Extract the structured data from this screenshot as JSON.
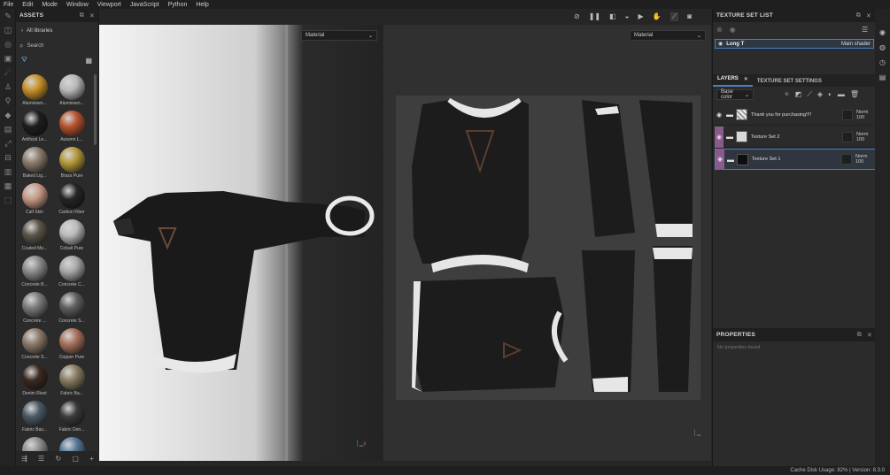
{
  "menu": [
    "File",
    "Edit",
    "Mode",
    "Window",
    "Viewport",
    "JavaScript",
    "Python",
    "Help"
  ],
  "assets": {
    "title": "ASSETS",
    "all_libraries": "All libraries",
    "search_placeholder": "Search",
    "materials": [
      {
        "label": "Aluminium...",
        "color": "#c9922a"
      },
      {
        "label": "Aluminium...",
        "color": "#b9b9b9"
      },
      {
        "label": "Artificial Le...",
        "color": "#1e1e1e"
      },
      {
        "label": "Autumn L...",
        "color": "#b8542f"
      },
      {
        "label": "Baked Lig...",
        "color": "#8c7c6c"
      },
      {
        "label": "Brass Pure",
        "color": "#b59a3a"
      },
      {
        "label": "Calf Skin",
        "color": "#c99a86"
      },
      {
        "label": "Carbon Fiber",
        "color": "#252525"
      },
      {
        "label": "Coated Me...",
        "color": "#5c5548"
      },
      {
        "label": "Cobalt Pure",
        "color": "#bcbcbc"
      },
      {
        "label": "Concrete B...",
        "color": "#8c8c8c"
      },
      {
        "label": "Concrete C...",
        "color": "#a9a9a9"
      },
      {
        "label": "Concrete ...",
        "color": "#7c7c7c"
      },
      {
        "label": "Concrete S...",
        "color": "#606060"
      },
      {
        "label": "Concrete S...",
        "color": "#8c7a6a"
      },
      {
        "label": "Copper Pure",
        "color": "#a8725c"
      },
      {
        "label": "Denim Rivet",
        "color": "#3a2a20"
      },
      {
        "label": "Fabric Ba...",
        "color": "#8a7e62"
      },
      {
        "label": "Fabric Bas...",
        "color": "#4a5a66"
      },
      {
        "label": "Fabric Den...",
        "color": "#3a3a3a"
      },
      {
        "label": "",
        "color": "#909090"
      },
      {
        "label": "",
        "color": "#567a9a"
      }
    ]
  },
  "viewport": {
    "left_dropdown": "Material",
    "right_dropdown": "Material"
  },
  "texture_set_list": {
    "title": "TEXTURE SET LIST",
    "item_name": "Long T",
    "item_shader": "Main shader"
  },
  "layers": {
    "tab_layers": "LAYERS",
    "tab_settings": "TEXTURE SET SETTINGS",
    "channel": "Base color",
    "rows": [
      {
        "name": "Thank you for purchasing!!!!",
        "blend": "Norm",
        "opacity": "100",
        "selected": false
      },
      {
        "name": "Texture Set 2",
        "blend": "Norm",
        "opacity": "100",
        "selected": false
      },
      {
        "name": "Texture Set 1",
        "blend": "Norm",
        "opacity": "100",
        "selected": true
      }
    ]
  },
  "properties": {
    "title": "PROPERTIES",
    "empty": "No properties found"
  },
  "status": {
    "text": "Cache Disk Usage:  82% | Version: 8.3.0"
  }
}
